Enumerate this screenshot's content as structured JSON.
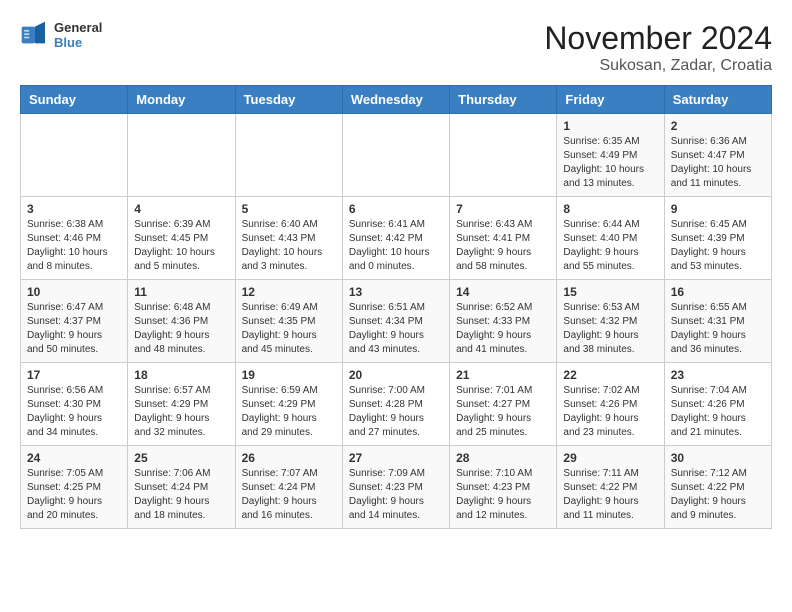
{
  "header": {
    "logo_line1": "General",
    "logo_line2": "Blue",
    "title": "November 2024",
    "subtitle": "Sukosan, Zadar, Croatia"
  },
  "calendar": {
    "days_of_week": [
      "Sunday",
      "Monday",
      "Tuesday",
      "Wednesday",
      "Thursday",
      "Friday",
      "Saturday"
    ],
    "weeks": [
      [
        {
          "day": "",
          "content": ""
        },
        {
          "day": "",
          "content": ""
        },
        {
          "day": "",
          "content": ""
        },
        {
          "day": "",
          "content": ""
        },
        {
          "day": "",
          "content": ""
        },
        {
          "day": "1",
          "content": "Sunrise: 6:35 AM\nSunset: 4:49 PM\nDaylight: 10 hours and 13 minutes."
        },
        {
          "day": "2",
          "content": "Sunrise: 6:36 AM\nSunset: 4:47 PM\nDaylight: 10 hours and 11 minutes."
        }
      ],
      [
        {
          "day": "3",
          "content": "Sunrise: 6:38 AM\nSunset: 4:46 PM\nDaylight: 10 hours and 8 minutes."
        },
        {
          "day": "4",
          "content": "Sunrise: 6:39 AM\nSunset: 4:45 PM\nDaylight: 10 hours and 5 minutes."
        },
        {
          "day": "5",
          "content": "Sunrise: 6:40 AM\nSunset: 4:43 PM\nDaylight: 10 hours and 3 minutes."
        },
        {
          "day": "6",
          "content": "Sunrise: 6:41 AM\nSunset: 4:42 PM\nDaylight: 10 hours and 0 minutes."
        },
        {
          "day": "7",
          "content": "Sunrise: 6:43 AM\nSunset: 4:41 PM\nDaylight: 9 hours and 58 minutes."
        },
        {
          "day": "8",
          "content": "Sunrise: 6:44 AM\nSunset: 4:40 PM\nDaylight: 9 hours and 55 minutes."
        },
        {
          "day": "9",
          "content": "Sunrise: 6:45 AM\nSunset: 4:39 PM\nDaylight: 9 hours and 53 minutes."
        }
      ],
      [
        {
          "day": "10",
          "content": "Sunrise: 6:47 AM\nSunset: 4:37 PM\nDaylight: 9 hours and 50 minutes."
        },
        {
          "day": "11",
          "content": "Sunrise: 6:48 AM\nSunset: 4:36 PM\nDaylight: 9 hours and 48 minutes."
        },
        {
          "day": "12",
          "content": "Sunrise: 6:49 AM\nSunset: 4:35 PM\nDaylight: 9 hours and 45 minutes."
        },
        {
          "day": "13",
          "content": "Sunrise: 6:51 AM\nSunset: 4:34 PM\nDaylight: 9 hours and 43 minutes."
        },
        {
          "day": "14",
          "content": "Sunrise: 6:52 AM\nSunset: 4:33 PM\nDaylight: 9 hours and 41 minutes."
        },
        {
          "day": "15",
          "content": "Sunrise: 6:53 AM\nSunset: 4:32 PM\nDaylight: 9 hours and 38 minutes."
        },
        {
          "day": "16",
          "content": "Sunrise: 6:55 AM\nSunset: 4:31 PM\nDaylight: 9 hours and 36 minutes."
        }
      ],
      [
        {
          "day": "17",
          "content": "Sunrise: 6:56 AM\nSunset: 4:30 PM\nDaylight: 9 hours and 34 minutes."
        },
        {
          "day": "18",
          "content": "Sunrise: 6:57 AM\nSunset: 4:29 PM\nDaylight: 9 hours and 32 minutes."
        },
        {
          "day": "19",
          "content": "Sunrise: 6:59 AM\nSunset: 4:29 PM\nDaylight: 9 hours and 29 minutes."
        },
        {
          "day": "20",
          "content": "Sunrise: 7:00 AM\nSunset: 4:28 PM\nDaylight: 9 hours and 27 minutes."
        },
        {
          "day": "21",
          "content": "Sunrise: 7:01 AM\nSunset: 4:27 PM\nDaylight: 9 hours and 25 minutes."
        },
        {
          "day": "22",
          "content": "Sunrise: 7:02 AM\nSunset: 4:26 PM\nDaylight: 9 hours and 23 minutes."
        },
        {
          "day": "23",
          "content": "Sunrise: 7:04 AM\nSunset: 4:26 PM\nDaylight: 9 hours and 21 minutes."
        }
      ],
      [
        {
          "day": "24",
          "content": "Sunrise: 7:05 AM\nSunset: 4:25 PM\nDaylight: 9 hours and 20 minutes."
        },
        {
          "day": "25",
          "content": "Sunrise: 7:06 AM\nSunset: 4:24 PM\nDaylight: 9 hours and 18 minutes."
        },
        {
          "day": "26",
          "content": "Sunrise: 7:07 AM\nSunset: 4:24 PM\nDaylight: 9 hours and 16 minutes."
        },
        {
          "day": "27",
          "content": "Sunrise: 7:09 AM\nSunset: 4:23 PM\nDaylight: 9 hours and 14 minutes."
        },
        {
          "day": "28",
          "content": "Sunrise: 7:10 AM\nSunset: 4:23 PM\nDaylight: 9 hours and 12 minutes."
        },
        {
          "day": "29",
          "content": "Sunrise: 7:11 AM\nSunset: 4:22 PM\nDaylight: 9 hours and 11 minutes."
        },
        {
          "day": "30",
          "content": "Sunrise: 7:12 AM\nSunset: 4:22 PM\nDaylight: 9 hours and 9 minutes."
        }
      ]
    ]
  }
}
